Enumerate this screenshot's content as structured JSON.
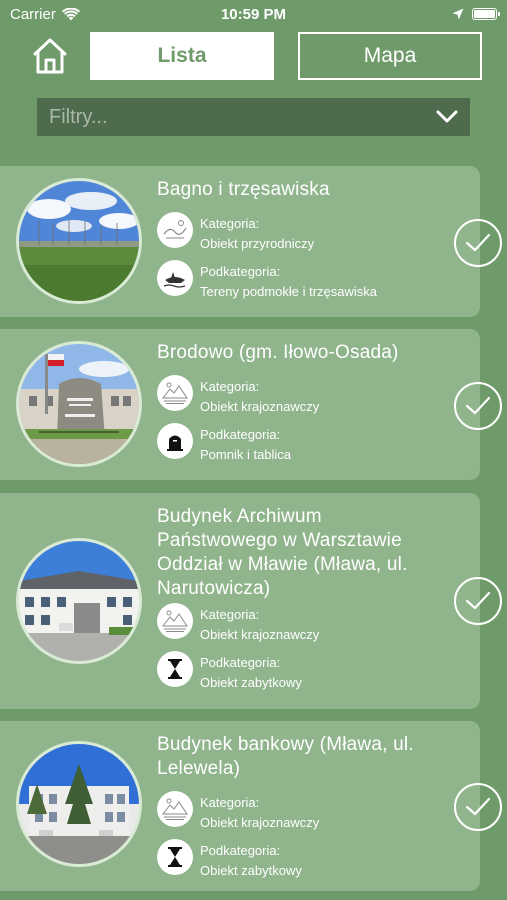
{
  "status_bar": {
    "carrier": "Carrier",
    "time": "10:59 PM"
  },
  "nav": {
    "tab_list": "Lista",
    "tab_map": "Mapa"
  },
  "filter": {
    "placeholder": "Filtry..."
  },
  "items": [
    {
      "title": "Bagno i trzęsawiska",
      "category_label": "Kategoria:",
      "category_value": "Obiekt przyrodniczy",
      "category_icon": "nature-icon",
      "subcategory_label": "Podkategoria:",
      "subcategory_value": "Tereny podmokłe i trzęsawiska",
      "subcategory_icon": "wetland-icon"
    },
    {
      "title": "Brodowo (gm. Iłowo-Osada)",
      "category_label": "Kategoria:",
      "category_value": "Obiekt krajoznawczy",
      "category_icon": "landscape-icon",
      "subcategory_label": "Podkategoria:",
      "subcategory_value": "Pomnik i tablica",
      "subcategory_icon": "monument-icon"
    },
    {
      "title": "Budynek Archiwum Państwowego w Warsztawie Oddział w Mławie (Mława, ul. Narutowicza)",
      "category_label": "Kategoria:",
      "category_value": "Obiekt krajoznawczy",
      "category_icon": "landscape-icon",
      "subcategory_label": "Podkategoria:",
      "subcategory_value": "Obiekt zabytkowy",
      "subcategory_icon": "hourglass-icon"
    },
    {
      "title": "Budynek bankowy (Mława, ul. Lelewela)",
      "category_label": "Kategoria:",
      "category_value": "Obiekt krajoznawczy",
      "category_icon": "landscape-icon",
      "subcategory_label": "Podkategoria:",
      "subcategory_value": "Obiekt zabytkowy",
      "subcategory_icon": "hourglass-icon"
    }
  ]
}
